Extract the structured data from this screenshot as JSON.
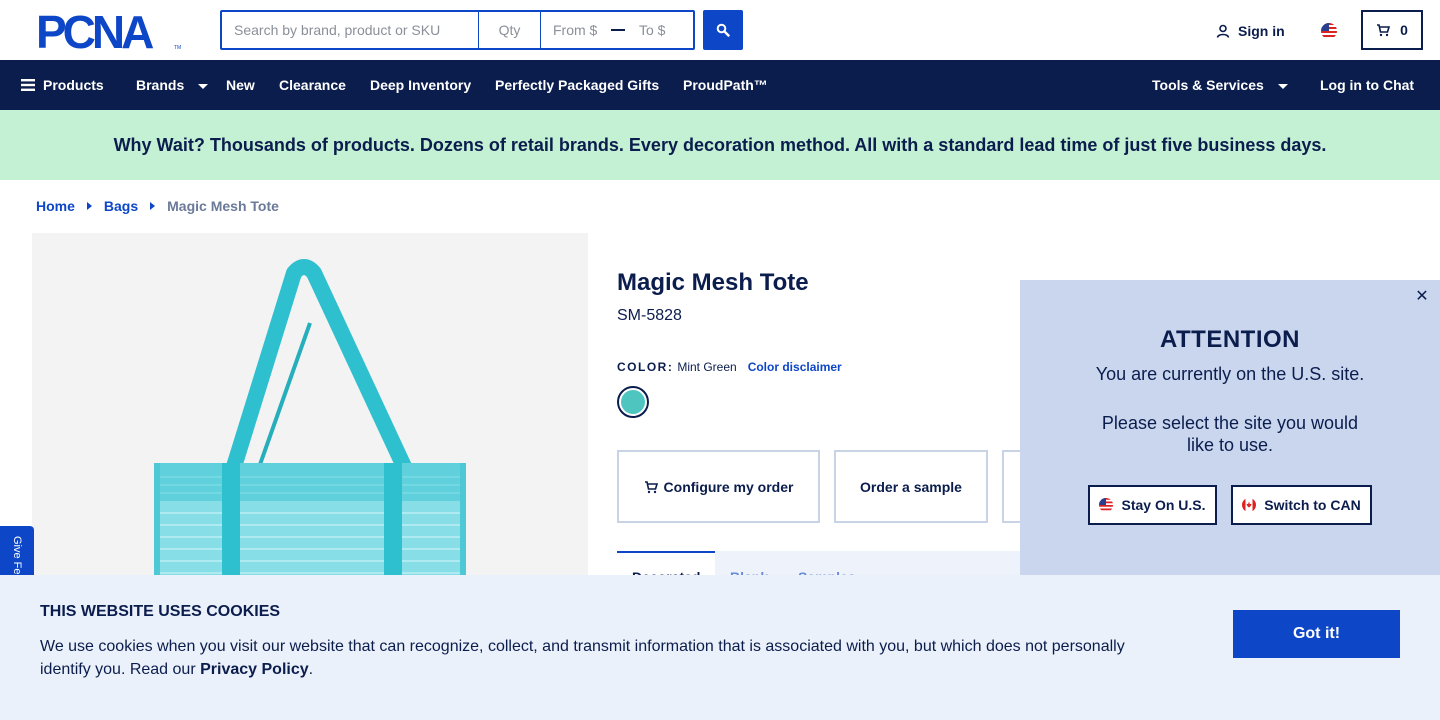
{
  "header": {
    "logo_text": "PCNA",
    "search": {
      "placeholder": "Search by brand, product or SKU",
      "qty_placeholder": "Qty",
      "from_placeholder": "From $",
      "to_placeholder": "To $"
    },
    "signin_label": "Sign in",
    "cart_count": "0"
  },
  "nav": {
    "products": "Products",
    "brands": "Brands",
    "new": "New",
    "clearance": "Clearance",
    "deep_inventory": "Deep Inventory",
    "gifts": "Perfectly Packaged Gifts",
    "proudpath": "ProudPath™",
    "tools": "Tools & Services",
    "chat": "Log in to Chat"
  },
  "banner": {
    "text": "Why Wait? Thousands of products. Dozens of retail brands. Every decoration method. All with a standard lead time of just five business days."
  },
  "breadcrumb": {
    "home": "Home",
    "bags": "Bags",
    "current": "Magic Mesh Tote"
  },
  "product": {
    "title": "Magic Mesh Tote",
    "sku": "SM-5828",
    "color_label": "COLOR:",
    "color_value": "Mint Green",
    "color_disclaimer": "Color disclaimer",
    "swatch_color": "#4fc5c0",
    "configure_label": "Configure my order",
    "sample_label": "Order a sample",
    "tab_partial_1": "Decorated",
    "tab_partial_2": "Blank",
    "tab_partial_3": "Samples"
  },
  "modal": {
    "title": "ATTENTION",
    "line1": "You are currently on the U.S. site.",
    "line2": "Please select the site you would like to use.",
    "stay_label": "Stay On U.S.",
    "switch_label": "Switch to CAN"
  },
  "feedback": {
    "label": "Give Feedback"
  },
  "cookies": {
    "title": "THIS WEBSITE USES COOKIES",
    "text": "We use cookies when you visit our website that can recognize, collect, and transmit information that is associated with you, but which does not personally identify you. Read our",
    "policy_link": "Privacy Policy",
    "period": ".",
    "accept_label": "Got it!"
  },
  "colors": {
    "brand_navy": "#0b1d4d",
    "brand_blue": "#0d47c7",
    "banner_green": "#c4f0d4",
    "modal_bg": "#c9d6ee",
    "cookie_bg": "#ebf1fa"
  }
}
